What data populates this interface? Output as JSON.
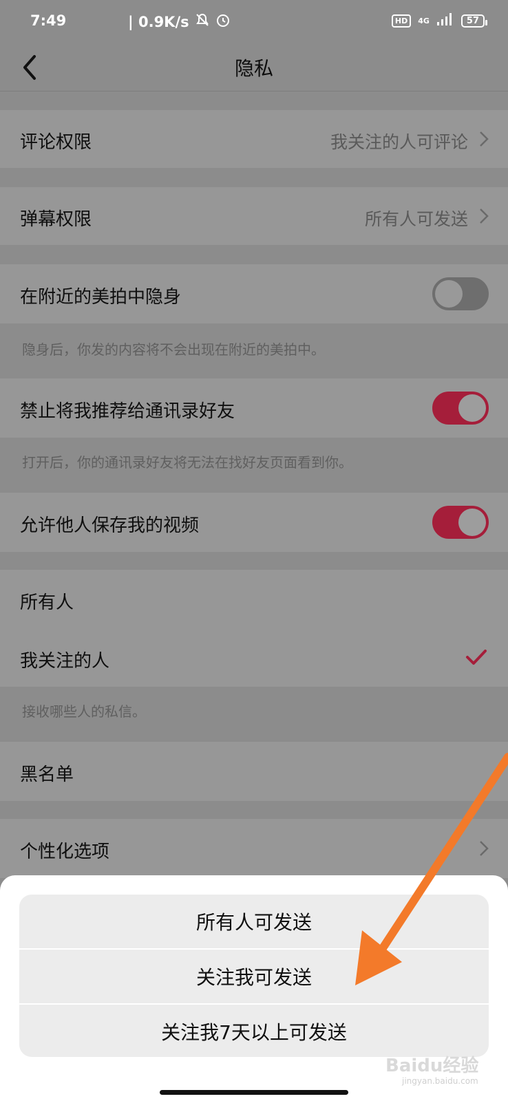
{
  "status_bar": {
    "time": "7:49",
    "speed": "| 0.9K/s",
    "hd": "HD",
    "network": "4G",
    "battery": "57"
  },
  "nav": {
    "title": "隐私",
    "back_icon": "back-chevron-icon"
  },
  "settings": {
    "comment_permission": {
      "label": "评论权限",
      "value": "我关注的人可评论"
    },
    "danmaku_permission": {
      "label": "弹幕权限",
      "value": "所有人可发送"
    },
    "hide_nearby": {
      "label": "在附近的美拍中隐身",
      "state": "off",
      "hint": "隐身后，你发的内容将不会出现在附近的美拍中。"
    },
    "no_recommend_contacts": {
      "label": "禁止将我推荐给通讯录好友",
      "state": "on",
      "hint": "打开后，你的通讯录好友将无法在找好友页面看到你。"
    },
    "allow_save_video": {
      "label": "允许他人保存我的视频",
      "state": "on"
    },
    "message_everyone": {
      "label": "所有人"
    },
    "message_following": {
      "label": "我关注的人",
      "selected": true
    },
    "message_hint": "接收哪些人的私信。",
    "blacklist": {
      "label": "黑名单"
    },
    "personalization": {
      "label": "个性化选项"
    }
  },
  "action_sheet": {
    "options": [
      "所有人可发送",
      "关注我可发送",
      "关注我7天以上可发送"
    ]
  },
  "watermark": {
    "brand": "Baidu经验",
    "url": "jingyan.baidu.com"
  },
  "colors": {
    "accent": "#a51e3a",
    "arrow": "#f37a2a"
  }
}
